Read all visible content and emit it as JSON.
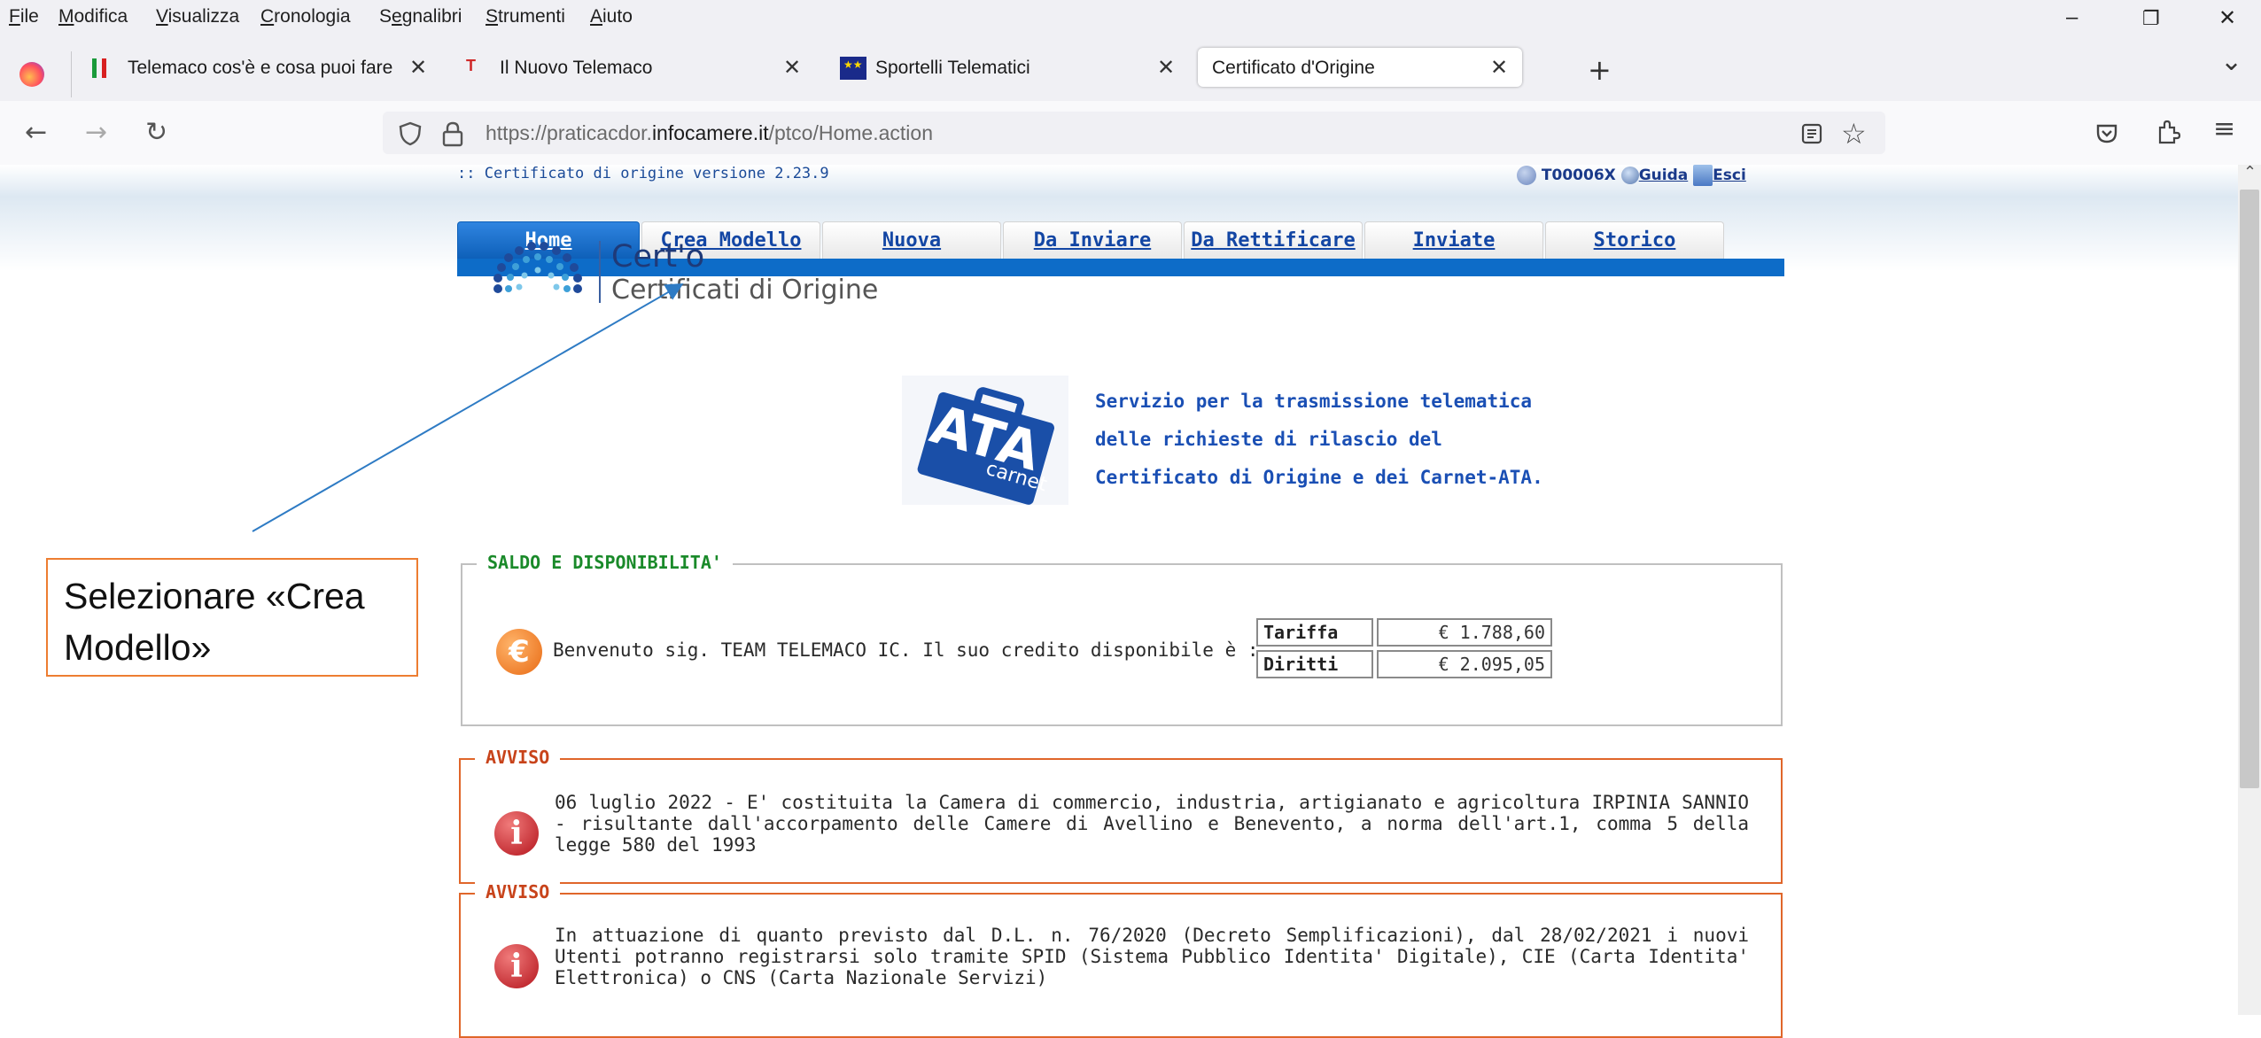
{
  "menu": [
    "File",
    "Modifica",
    "Visualizza",
    "Cronologia",
    "Segnalibri",
    "Strumenti",
    "Aiuto"
  ],
  "menu_underline": [
    "F",
    "M",
    "V",
    "C",
    "e",
    "S",
    "A"
  ],
  "window_controls": {
    "minimize": "–",
    "restore": "❐",
    "close": "✕"
  },
  "tabs": [
    {
      "title": "Telemaco cos'è e cosa puoi fare",
      "close": "✕",
      "icon": "flag-icon"
    },
    {
      "title": "Il Nuovo Telemaco",
      "close": "✕",
      "icon": "telemaco-icon"
    },
    {
      "title": "Sportelli Telematici",
      "close": "✕",
      "icon": "eu-flag-icon"
    },
    {
      "title": "Certificato d'Origine",
      "close": "✕",
      "icon": "none"
    }
  ],
  "new_tab": "+",
  "tab_list": "⌄",
  "nav": {
    "back": "←",
    "forward": "→",
    "reload": "↻"
  },
  "url": {
    "pre": "https://praticacdor.",
    "domain": "infocamere.it",
    "post": "/ptco/Home.action"
  },
  "page": {
    "version": ":: Certificato di origine versione 2.23.9",
    "user": "T00006X",
    "guida": "Guida",
    "esci": "Esci",
    "navtabs": [
      "Home",
      "Crea Modello",
      "Nuova",
      "Da Inviare",
      "Da Rettificare",
      "Inviate",
      "Storico"
    ],
    "cert_name": "Cert'o",
    "cert_sub": "Certificati di Origine",
    "ata_big": "ATA",
    "ata_small": "carnet",
    "service": [
      "Servizio per la trasmissione telematica",
      "delle richieste di rilascio del",
      "Certificato di Origine e dei Carnet-ATA."
    ],
    "saldo_legend": "SALDO E DISPONIBILITA'",
    "euro_symbol": "€",
    "welcome": "Benvenuto sig. TEAM TELEMACO IC. Il suo credito disponibile è :",
    "credits": [
      {
        "label": "Tariffa",
        "value": "€ 1.788,60"
      },
      {
        "label": "Diritti",
        "value": "€ 2.095,05"
      }
    ],
    "avvisi": [
      {
        "legend": "AVVISO",
        "text": "06 luglio 2022 - E' costituita la Camera di commercio, industria, artigianato e agricoltura IRPINIA SANNIO - risultante dall'accorpamento delle Camere di Avellino e Benevento, a norma dell'art.1, comma 5 della legge 580 del 1993"
      },
      {
        "legend": "AVVISO",
        "text": "In attuazione di quanto previsto dal D.L. n. 76/2020 (Decreto Semplificazioni), dal 28/02/2021 i nuovi Utenti potranno registrarsi solo tramite SPID (Sistema Pubblico Identita' Digitale), CIE (Carta Identita' Elettronica) o CNS (Carta Nazionale Servizi)"
      }
    ],
    "info_symbol": "i"
  },
  "annotation": {
    "line1": "Selezionare «Crea",
    "line2": "Modello»"
  },
  "colors": {
    "accent": "#0d6cc8",
    "tab_text": "#1346a4",
    "legend_green": "#1a8a2a",
    "legend_red": "#c8431a",
    "callout_border": "#ed7d31",
    "arrow": "#2e7bc4"
  }
}
